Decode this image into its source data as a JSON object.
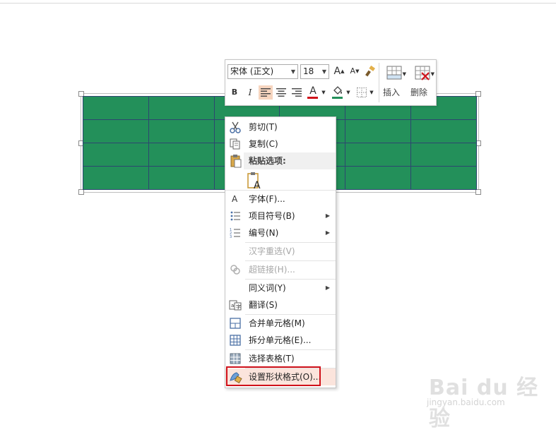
{
  "toolbar": {
    "font_name": "宋体 (正文)",
    "font_size": "18",
    "grow_font": "A",
    "shrink_font": "A",
    "bold": "B",
    "italic": "I",
    "font_color_glyph": "A",
    "insert_label": "插入",
    "delete_label": "删除",
    "accent_red": "#d0121b",
    "accent_green": "#23905a"
  },
  "table": {
    "rows": 4,
    "cols": 6,
    "fill_color": "#23905a"
  },
  "menu": {
    "cut": "剪切(T)",
    "copy": "复制(C)",
    "paste_options": "粘贴选项:",
    "font": "字体(F)...",
    "bullets": "项目符号(B)",
    "numbering": "编号(N)",
    "reconversion": "汉字重选(V)",
    "hyperlink": "超链接(H)...",
    "synonyms": "同义词(Y)",
    "translate": "翻译(S)",
    "merge_cells": "合并单元格(M)",
    "split_cells": "拆分单元格(E)...",
    "select_table": "选择表格(T)",
    "format_shape": "设置形状格式(O)..."
  },
  "watermark": {
    "main": "Bai du 经验",
    "sub": "jingyan.baidu.com"
  }
}
